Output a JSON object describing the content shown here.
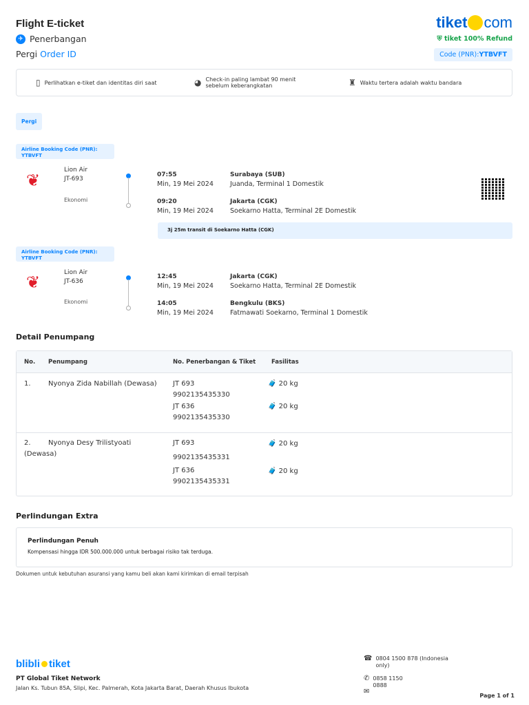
{
  "header": {
    "title": "Flight E-ticket",
    "category": "Penerbangan",
    "direction": "Pergi",
    "order_id_label": "Order ID",
    "logo": {
      "left": "tiket",
      "right": "com"
    },
    "refund": "tiket 100% Refund",
    "pnr_label": "Code (PNR):",
    "pnr_value": "YTBVFT"
  },
  "info": [
    {
      "icon": "id-card-icon",
      "text": "Perlihatkan e-tiket dan identitas diri saat"
    },
    {
      "icon": "clock-icon",
      "text": "Check-in paling lambat 90 menit sebelum  keberangkatan"
    },
    {
      "icon": "airport-tower-icon",
      "text": "Waktu tertera adalah waktu bandara"
    }
  ],
  "tab": "Pergi",
  "flights": [
    {
      "pnr": "Airline Booking Code (PNR): YTBVFT",
      "airline": "Lion Air JT-693",
      "class": "Ekonomi",
      "dep": {
        "time": "07:55",
        "date": "Min, 19 Mei 2024",
        "city": "Surabaya (SUB)",
        "airport": "Juanda, Terminal 1 Domestik"
      },
      "arr": {
        "time": "09:20",
        "date": "Min, 19 Mei 2024",
        "city": "Jakarta (CGK)",
        "airport": "Soekarno Hatta, Terminal 2E Domestik"
      }
    },
    {
      "pnr": "Airline Booking Code (PNR): YTBVFT",
      "airline": "Lion Air JT-636",
      "class": "Ekonomi",
      "dep": {
        "time": "12:45",
        "date": "Min, 19 Mei 2024",
        "city": "Jakarta (CGK)",
        "airport": "Soekarno Hatta, Terminal 2E Domestik"
      },
      "arr": {
        "time": "14:05",
        "date": "Min, 19 Mei 2024",
        "city": "Bengkulu (BKS)",
        "airport": "Fatmawati Soekarno, Terminal 1 Domestik"
      }
    }
  ],
  "transit": "3j 25m transit di Soekarno Hatta (CGK)",
  "passengers": {
    "title": "Detail Penumpang",
    "headers": [
      "No.",
      "Penumpang",
      "No. Penerbangan & Tiket",
      "Fasilitas"
    ],
    "rows": [
      {
        "no": "1.",
        "name": "Nyonya Zida Nabillah (Dewasa)",
        "f1": "JT 693",
        "t1": "9902135435330",
        "b1": "20 kg",
        "f2": "JT 636",
        "t2": "9902135435330",
        "b2": "20 kg"
      },
      {
        "no": "2.",
        "name": "Nyonya Desy Trilistyoati (Dewasa)",
        "f1": "JT 693",
        "t1": "9902135435331",
        "b1": "20 kg",
        "f2": "JT 636",
        "t2": "9902135435331",
        "b2": "20 kg"
      }
    ]
  },
  "protection": {
    "title": "Perlindungan  Extra",
    "name": "Perlindungan Penuh",
    "desc": "Kompensasi hingga IDR 500.000.000 untuk berbagai risiko tak terduga.",
    "note": "Dokumen untuk kebutuhan asuransi yang kamu beli akan kami kirimkan di email terpisah"
  },
  "footer": {
    "logo": {
      "left": "blibli",
      "right": "tiket"
    },
    "company": "PT Global Tiket Network",
    "address": "Jalan Ks. Tubun 85A, Slipi, Kec. Palmerah, Kota Jakarta Barat, Daerah Khusus Ibukota",
    "phone": "0804 1500 878 (Indonesia only)",
    "whatsapp": "0858 1150 0888",
    "page": "Page 1 of 1"
  }
}
